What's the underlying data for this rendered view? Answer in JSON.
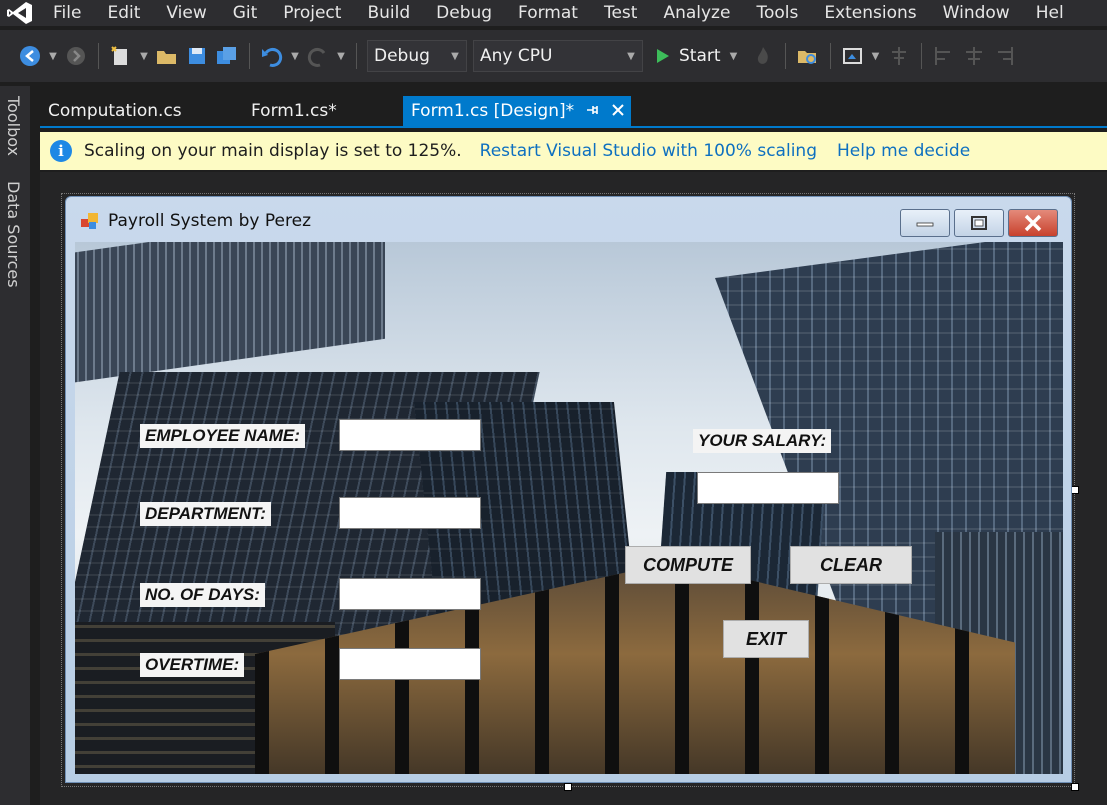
{
  "menubar": {
    "items": [
      "File",
      "Edit",
      "View",
      "Git",
      "Project",
      "Build",
      "Debug",
      "Format",
      "Test",
      "Analyze",
      "Tools",
      "Extensions",
      "Window",
      "Hel"
    ]
  },
  "toolbar": {
    "config": "Debug",
    "platform": "Any CPU",
    "start_label": "Start"
  },
  "left_rail": {
    "toolbox": "Toolbox",
    "data_sources": "Data Sources"
  },
  "tabs": [
    {
      "label": "Computation.cs"
    },
    {
      "label": "Form1.cs*"
    },
    {
      "label": "Form1.cs [Design]*"
    }
  ],
  "info_bar": {
    "message": "Scaling on your main display is set to 125%.",
    "link_restart": "Restart Visual Studio with 100% scaling",
    "link_help": "Help me decide"
  },
  "form": {
    "title": "Payroll System by Perez",
    "labels": {
      "employee_name": "EMPLOYEE NAME:",
      "department": "DEPARTMENT:",
      "days": "NO. OF DAYS:",
      "overtime": "OVERTIME:",
      "salary": "YOUR SALARY:"
    },
    "buttons": {
      "compute": "COMPUTE",
      "clear": "CLEAR",
      "exit": "EXIT"
    }
  },
  "colors": {
    "accent": "#007acc",
    "info_bar": "#fdfbc4",
    "link": "#0e70c0",
    "close_red": "#c8412c"
  }
}
